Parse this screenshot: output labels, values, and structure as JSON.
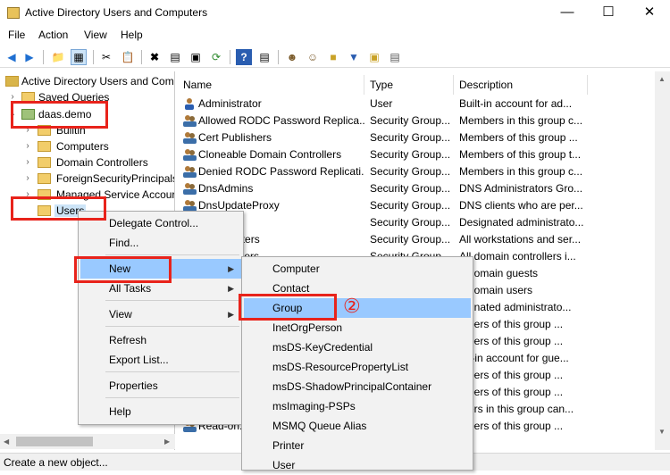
{
  "window": {
    "title": "Active Directory Users and Computers"
  },
  "menubar": [
    "File",
    "Action",
    "View",
    "Help"
  ],
  "tree": {
    "root": "Active Directory Users and Com",
    "saved_queries": "Saved Queries",
    "domain": "daas.demo",
    "children": [
      "Builtin",
      "Computers",
      "Domain Controllers",
      "ForeignSecurityPrincipals",
      "Managed Service Accour",
      "Users"
    ]
  },
  "list": {
    "headers": [
      "Name",
      "Type",
      "Description"
    ],
    "rows": [
      {
        "name": "Administrator",
        "type": "User",
        "desc": "Built-in account for ad..."
      },
      {
        "name": "Allowed RODC Password Replica...",
        "type": "Security Group...",
        "desc": "Members in this group c..."
      },
      {
        "name": "Cert Publishers",
        "type": "Security Group...",
        "desc": "Members of this group ..."
      },
      {
        "name": "Cloneable Domain Controllers",
        "type": "Security Group...",
        "desc": "Members of this group t..."
      },
      {
        "name": "Denied RODC Password Replicati...",
        "type": "Security Group...",
        "desc": "Members in this group c..."
      },
      {
        "name": "DnsAdmins",
        "type": "Security Group...",
        "desc": "DNS Administrators Gro..."
      },
      {
        "name": "DnsUpdateProxy",
        "type": "Security Group...",
        "desc": "DNS clients who are per..."
      },
      {
        "name": "...Admins",
        "type": "Security Group...",
        "desc": "Designated administrato..."
      },
      {
        "name": "...Computers",
        "type": "Security Group...",
        "desc": "All workstations and ser..."
      },
      {
        "name": "...Controllers",
        "type": "Security Group...",
        "desc": "All domain controllers i..."
      },
      {
        "name": "",
        "type": "",
        "desc": "...domain guests"
      },
      {
        "name": "",
        "type": "",
        "desc": "...domain users"
      },
      {
        "name": "",
        "type": "",
        "desc": "...gnated administrato..."
      },
      {
        "name": "",
        "type": "",
        "desc": "...bers of this group ..."
      },
      {
        "name": "",
        "type": "",
        "desc": "...bers of this group ..."
      },
      {
        "name": "",
        "type": "",
        "desc": "...t-in account for gue..."
      },
      {
        "name": "",
        "type": "",
        "desc": "...bers of this group ..."
      },
      {
        "name": "",
        "type": "",
        "desc": "...bers of this group ..."
      },
      {
        "name": "RAS and ...",
        "type": "",
        "desc": "...ers in this group can..."
      },
      {
        "name": "Read-on...",
        "type": "",
        "desc": "...bers of this group ..."
      }
    ]
  },
  "context_menu": {
    "items": [
      "Delegate Control...",
      "Find...",
      "New",
      "All Tasks",
      "View",
      "Refresh",
      "Export List...",
      "Properties",
      "Help"
    ]
  },
  "new_submenu": {
    "items": [
      "Computer",
      "Contact",
      "Group",
      "InetOrgPerson",
      "msDS-KeyCredential",
      "msDS-ResourcePropertyList",
      "msDS-ShadowPrincipalContainer",
      "msImaging-PSPs",
      "MSMQ Queue Alias",
      "Printer",
      "User"
    ]
  },
  "annotation": {
    "step": "②"
  },
  "status": {
    "text": "Create a new object..."
  },
  "colors": {
    "highlight": "#99c9ff",
    "callout": "#e8231b"
  }
}
